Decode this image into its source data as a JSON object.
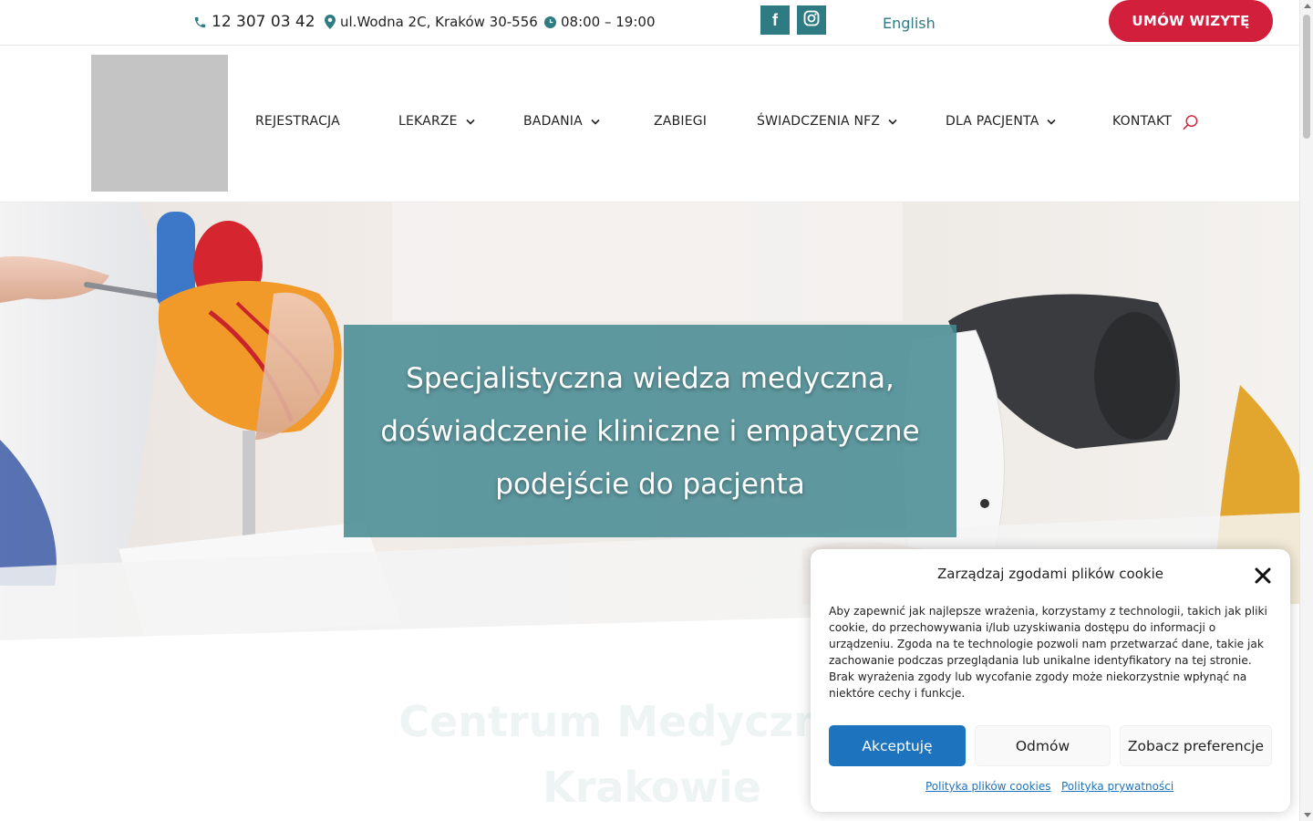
{
  "topbar": {
    "phone": "12 307 03 42",
    "address": "ul.Wodna 2C, Kraków 30-556",
    "hours": "08:00 – 19:00",
    "facebook_letter": "f",
    "language": "English",
    "cta_label": "UMÓW WIZYTĘ"
  },
  "nav": {
    "items": [
      {
        "label": "REJESTRACJA"
      },
      {
        "label": "LEKARZE"
      },
      {
        "label": "BADANIA"
      },
      {
        "label": "ZABIEGI"
      },
      {
        "label": "ŚWIADCZENIA NFZ"
      },
      {
        "label": "DLA PACJENTA"
      },
      {
        "label": "KONTAKT"
      }
    ]
  },
  "hero": {
    "headline": "Specjalistyczna wiedza medyczna, doświadczenie kliniczne i empatyczne podejście do pacjenta"
  },
  "section": {
    "title": "Centrum Medyczne w Krakowie"
  },
  "cookie": {
    "title": "Zarządzaj zgodami plików cookie",
    "body": "Aby zapewnić jak najlepsze wrażenia, korzystamy z technologii, takich jak pliki cookie, do przechowywania i/lub uzyskiwania dostępu do informacji o urządzeniu. Zgoda na te technologie pozwoli nam przetwarzać dane, takie jak zachowanie podczas przeglądania lub unikalne identyfikatory na tej stronie. Brak wyrażenia zgody lub wycofanie zgody może niekorzystnie wpłynąć na niektóre cechy i funkcje.",
    "accept_label": "Akceptuję",
    "deny_label": "Odmów",
    "prefs_label": "Zobacz preferencje",
    "cookie_policy_link": "Polityka plików cookies",
    "privacy_policy_link": "Polityka prywatności"
  },
  "colors": {
    "accent": "#2f7b83",
    "cta": "#d21f3c",
    "accept": "#1e73be"
  },
  "icons": {
    "phone": "phone-icon",
    "address": "map-pin-icon",
    "hours": "clock-icon",
    "facebook": "facebook-icon",
    "instagram": "instagram-icon",
    "search": "search-icon",
    "close": "close-icon",
    "dropdown": "chevron-down-icon"
  }
}
